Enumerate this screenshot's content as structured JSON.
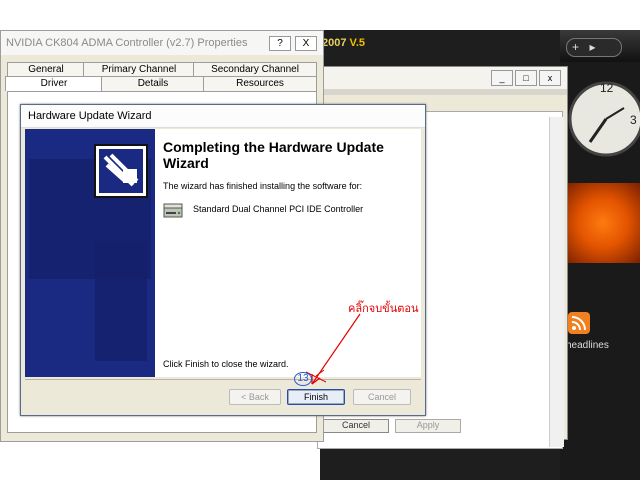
{
  "sidebar": {
    "controls": [
      "+",
      "▸"
    ],
    "clock_numerals": [
      "12",
      "3"
    ],
    "headlines_label": "headlines"
  },
  "bg_window": {
    "version_text": "2007",
    "version_suffix": "V.5"
  },
  "middle_window": {
    "controls": [
      "_",
      "□",
      "x"
    ],
    "cancel_label": "Cancel",
    "apply_label": "Apply"
  },
  "properties_dialog": {
    "title": "NVIDIA CK804 ADMA Controller (v2.7) Properties",
    "help_label": "?",
    "close_label": "X",
    "tabs_row1": [
      "General",
      "Primary Channel",
      "Secondary Channel"
    ],
    "tabs_row2": [
      "Driver",
      "Details",
      "Resources"
    ]
  },
  "wizard": {
    "title": "Hardware Update Wizard",
    "heading": "Completing the Hardware Update Wizard",
    "description": "The wizard has finished installing the software for:",
    "device_name": "Standard Dual Channel PCI IDE Controller",
    "closing_text": "Click Finish to close the wizard.",
    "back_label": "< Back",
    "finish_label": "Finish",
    "cancel_label": "Cancel"
  },
  "annotation": {
    "instruction_text": "คลิ๊กจบขั้นตอน",
    "step_number": "13"
  },
  "colors": {
    "wizard_panel": "#1a2a82",
    "annotation_red": "#e60000",
    "annotation_blue": "#2a5ad8",
    "sidebar_bg": "#1a1a1a"
  }
}
